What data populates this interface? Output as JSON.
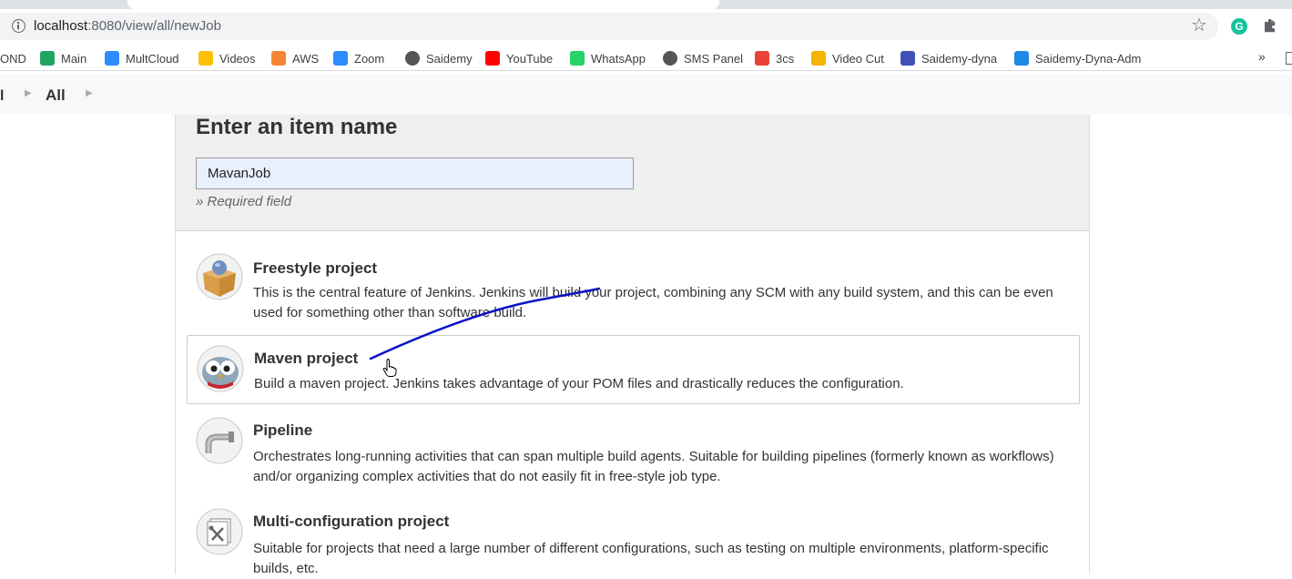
{
  "browser": {
    "url_host": "localhost",
    "url_path": ":8080/view/all/newJob",
    "bookmarks": [
      {
        "label": "OND",
        "icon": "bookmark-icon",
        "color": "#ffffff"
      },
      {
        "label": "Main",
        "icon": "google-drive-icon",
        "color": "#1fa463"
      },
      {
        "label": "MultCloud",
        "icon": "cloud-icon",
        "color": "#2d8cff"
      },
      {
        "label": "Videos",
        "icon": "google-drive-icon",
        "color": "#ffc107"
      },
      {
        "label": "AWS",
        "icon": "aws-cube-icon",
        "color": "#f58536"
      },
      {
        "label": "Zoom",
        "icon": "zoom-icon",
        "color": "#2d8cff"
      },
      {
        "label": "Saidemy",
        "icon": "dollar-icon",
        "color": "#555555"
      },
      {
        "label": "YouTube",
        "icon": "youtube-icon",
        "color": "#ff0000"
      },
      {
        "label": "WhatsApp",
        "icon": "whatsapp-icon",
        "color": "#25d366"
      },
      {
        "label": "SMS Panel",
        "icon": "globe-icon",
        "color": "#555555"
      },
      {
        "label": "3cs",
        "icon": "gmail-icon",
        "color": "#ea4335"
      },
      {
        "label": "Video Cut",
        "icon": "dots-icon",
        "color": "#f4b400"
      },
      {
        "label": "Saidemy-dyna",
        "icon": "chart-icon",
        "color": "#3f51b5"
      },
      {
        "label": "Saidemy-Dyna-Adm",
        "icon": "x-circle-icon",
        "color": "#1e88e5"
      }
    ],
    "overflow_chevron": "»"
  },
  "breadcrumb": {
    "edge_label": "l",
    "current": "All"
  },
  "form": {
    "title": "Enter an item name",
    "item_name_value": "MavanJob",
    "required_note": "» Required field"
  },
  "items": [
    {
      "title": "Freestyle project",
      "description": "This is the central feature of Jenkins. Jenkins will build your project, combining any SCM with any build system, and this can be even used for something other than software build.",
      "icon": "freestyle-box-icon"
    },
    {
      "title": "Maven project",
      "description": "Build a maven project. Jenkins takes advantage of your POM files and drastically reduces the configuration.",
      "icon": "maven-owl-icon",
      "selected": true
    },
    {
      "title": "Pipeline",
      "description": "Orchestrates long-running activities that can span multiple build agents. Suitable for building pipelines (formerly known as workflows) and/or organizing complex activities that do not easily fit in free-style job type.",
      "icon": "pipeline-icon"
    },
    {
      "title": "Multi-configuration project",
      "description": "Suitable for projects that need a large number of different configurations, such as testing on multiple environments, platform-specific builds, etc.",
      "icon": "multi-config-icon"
    }
  ],
  "colors": {
    "annotation_stroke": "#0a12c8",
    "input_bg": "#e8f0fe"
  }
}
